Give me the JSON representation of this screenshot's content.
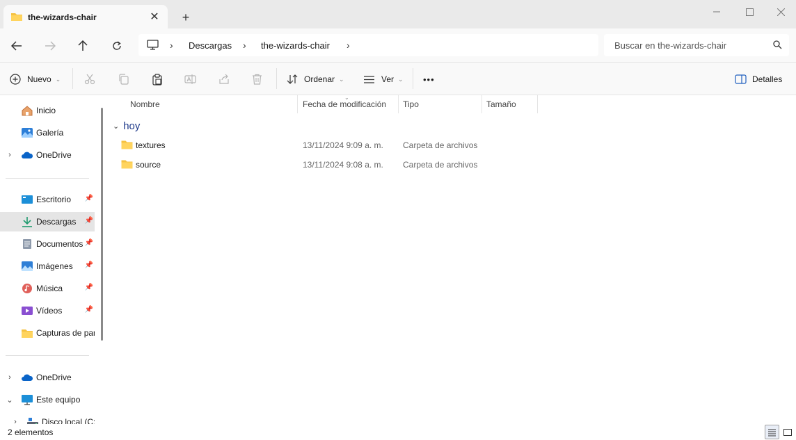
{
  "window": {
    "tab_title": "the-wizards-chair",
    "new_tab_symbol": "+",
    "close_tab_symbol": "✕"
  },
  "address": {
    "breadcrumbs": [
      "Descargas",
      "the-wizards-chair"
    ],
    "search_placeholder": "Buscar en the-wizards-chair"
  },
  "toolbar": {
    "new_label": "Nuevo",
    "sort_label": "Ordenar",
    "view_label": "Ver",
    "more_label": "•••",
    "details_label": "Detalles"
  },
  "sidebar": {
    "items": [
      {
        "label": "Inicio",
        "icon": "home-icon"
      },
      {
        "label": "Galería",
        "icon": "gallery-icon"
      },
      {
        "label": "OneDrive",
        "icon": "onedrive-icon"
      },
      {
        "label": "Escritorio",
        "icon": "desktop-icon",
        "pinned": true
      },
      {
        "label": "Descargas",
        "icon": "downloads-icon",
        "pinned": true,
        "selected": true
      },
      {
        "label": "Documentos",
        "icon": "documents-icon",
        "pinned": true
      },
      {
        "label": "Imágenes",
        "icon": "pictures-icon",
        "pinned": true
      },
      {
        "label": "Música",
        "icon": "music-icon",
        "pinned": true
      },
      {
        "label": "Vídeos",
        "icon": "videos-icon",
        "pinned": true
      },
      {
        "label": "Capturas de pantalla",
        "icon": "folder-icon"
      },
      {
        "label": "OneDrive",
        "icon": "onedrive-icon"
      },
      {
        "label": "Este equipo",
        "icon": "this-pc-icon"
      },
      {
        "label": "Disco local (C:)",
        "icon": "drive-icon"
      }
    ]
  },
  "columns": [
    "Nombre",
    "Fecha de modificación",
    "Tipo",
    "Tamaño"
  ],
  "group": {
    "label": "hoy"
  },
  "files": [
    {
      "name": "textures",
      "date": "13/11/2024 9:09 a. m.",
      "type": "Carpeta de archivos"
    },
    {
      "name": "source",
      "date": "13/11/2024 9:08 a. m.",
      "type": "Carpeta de archivos"
    }
  ],
  "status": {
    "count": "2 elementos"
  },
  "colors": {
    "folder": "#f5c242",
    "accent": "#0067c0",
    "group_label": "#1f3a8a"
  }
}
